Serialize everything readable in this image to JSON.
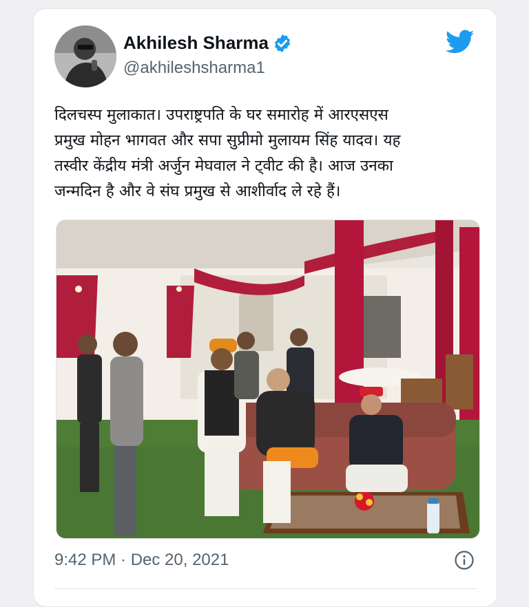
{
  "tweet": {
    "author": {
      "display_name": "Akhilesh Sharma",
      "handle": "@akhileshsharma1",
      "verified": true
    },
    "text_lines": [
      "दिलचस्प मुलाकात। उपराष्ट्रपति के घर समारोह में आरएसएस",
      "प्रमुख मोहन भागवत और सपा सुप्रीमो मुलायम सिंह यादव। यह",
      "तस्वीर केंद्रीय मंत्री अर्जुन मेघवाल ने ट्वीट की है। आज उनका",
      "जन्मदिन है और वे संघ प्रमुख से आशीर्वाद ले रहे हैं।"
    ],
    "timestamp": "9:42 PM · Dec 20, 2021"
  },
  "icons": {
    "verified": "verified-badge-icon",
    "brand": "twitter-bird-icon",
    "info": "info-icon"
  },
  "colors": {
    "twitter_blue": "#1d9bf0",
    "secondary_text": "#536471",
    "primary_text": "#0f1419"
  }
}
